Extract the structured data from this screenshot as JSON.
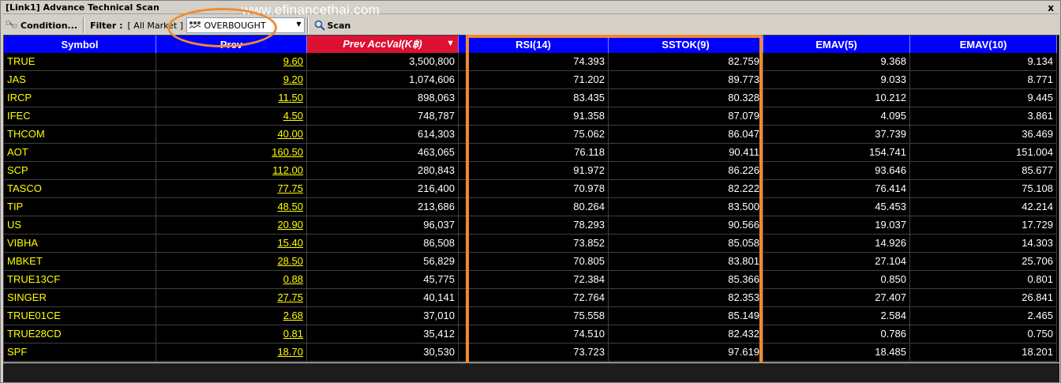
{
  "window": {
    "title": "[Link1] Advance Technical Scan",
    "close_glyph": "x"
  },
  "watermark": "www.efinancethai.com",
  "toolbar": {
    "condition_label": "Condition...",
    "filter_label": "Filter :",
    "filter_value": "[ All Market ]",
    "scan_type": "OVERBOUGHT",
    "scan_label": "Scan"
  },
  "columns": [
    "Symbol",
    "Prev",
    "Prev AccVal(K฿)",
    "RSI(14)",
    "SSTOK(9)",
    "EMAV(5)",
    "EMAV(10)"
  ],
  "sorted_column": "Prev AccVal(K฿)",
  "rows": [
    {
      "symbol": "TRUE",
      "prev": "9.60",
      "accval": "3,500,800",
      "rsi": "74.393",
      "sstok": "82.759",
      "emav5": "9.368",
      "emav10": "9.134"
    },
    {
      "symbol": "JAS",
      "prev": "9.20",
      "accval": "1,074,606",
      "rsi": "71.202",
      "sstok": "89.773",
      "emav5": "9.033",
      "emav10": "8.771"
    },
    {
      "symbol": "IRCP",
      "prev": "11.50",
      "accval": "898,063",
      "rsi": "83.435",
      "sstok": "80.328",
      "emav5": "10.212",
      "emav10": "9.445"
    },
    {
      "symbol": "IFEC",
      "prev": "4.50",
      "accval": "748,787",
      "rsi": "91.358",
      "sstok": "87.079",
      "emav5": "4.095",
      "emav10": "3.861"
    },
    {
      "symbol": "THCOM",
      "prev": "40.00",
      "accval": "614,303",
      "rsi": "75.062",
      "sstok": "86.047",
      "emav5": "37.739",
      "emav10": "36.469"
    },
    {
      "symbol": "AOT",
      "prev": "160.50",
      "accval": "463,065",
      "rsi": "76.118",
      "sstok": "90.411",
      "emav5": "154.741",
      "emav10": "151.004"
    },
    {
      "symbol": "SCP",
      "prev": "112.00",
      "accval": "280,843",
      "rsi": "91.972",
      "sstok": "86.226",
      "emav5": "93.646",
      "emav10": "85.677"
    },
    {
      "symbol": "TASCO",
      "prev": "77.75",
      "accval": "216,400",
      "rsi": "70.978",
      "sstok": "82.222",
      "emav5": "76.414",
      "emav10": "75.108"
    },
    {
      "symbol": "TIP",
      "prev": "48.50",
      "accval": "213,686",
      "rsi": "80.264",
      "sstok": "83.500",
      "emav5": "45.453",
      "emav10": "42.214"
    },
    {
      "symbol": "US",
      "prev": "20.90",
      "accval": "96,037",
      "rsi": "78.293",
      "sstok": "90.566",
      "emav5": "19.037",
      "emav10": "17.729"
    },
    {
      "symbol": "VIBHA",
      "prev": "15.40",
      "accval": "86,508",
      "rsi": "73.852",
      "sstok": "85.058",
      "emav5": "14.926",
      "emav10": "14.303"
    },
    {
      "symbol": "MBKET",
      "prev": "28.50",
      "accval": "56,829",
      "rsi": "70.805",
      "sstok": "83.801",
      "emav5": "27.104",
      "emav10": "25.706"
    },
    {
      "symbol": "TRUE13CF",
      "prev": "0.88",
      "accval": "45,775",
      "rsi": "72.384",
      "sstok": "85.366",
      "emav5": "0.850",
      "emav10": "0.801"
    },
    {
      "symbol": "SINGER",
      "prev": "27.75",
      "accval": "40,141",
      "rsi": "72.764",
      "sstok": "82.353",
      "emav5": "27.407",
      "emav10": "26.841"
    },
    {
      "symbol": "TRUE01CE",
      "prev": "2.68",
      "accval": "37,010",
      "rsi": "75.558",
      "sstok": "85.149",
      "emav5": "2.584",
      "emav10": "2.465"
    },
    {
      "symbol": "TRUE28CD",
      "prev": "0.81",
      "accval": "35,412",
      "rsi": "74.510",
      "sstok": "82.432",
      "emav5": "0.786",
      "emav10": "0.750"
    },
    {
      "symbol": "SPF",
      "prev": "18.70",
      "accval": "30,530",
      "rsi": "73.723",
      "sstok": "97.619",
      "emav5": "18.485",
      "emav10": "18.201"
    }
  ],
  "colors": {
    "header": "#0000ff",
    "sorted_header": "#dd1133",
    "symbol_text": "#ffff00",
    "highlight": "#f28a2f",
    "grid_bg": "#000000"
  }
}
